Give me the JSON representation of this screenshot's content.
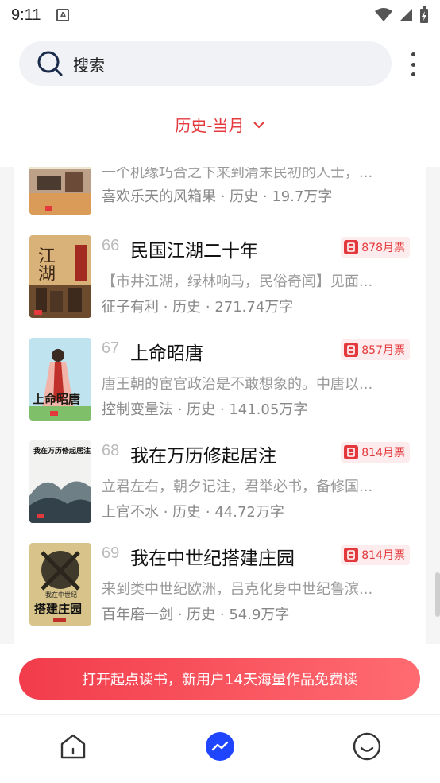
{
  "status": {
    "time": "9:11",
    "notification_glyph": "A"
  },
  "search": {
    "label": "搜索"
  },
  "filter": {
    "label": "历史-当月"
  },
  "books": [
    {
      "rank": "",
      "title": "",
      "tickets": "",
      "desc": "一个机缘巧合之下来到清末民初的人士，...",
      "meta": "喜欢乐天的风箱果 · 历史 · 19.7万字"
    },
    {
      "rank": "66",
      "title": "民国江湖二十年",
      "tickets": "878月票",
      "desc": "【市井江湖，绿林响马，民俗奇闻】见面...",
      "meta": "征子有利 · 历史 · 271.74万字"
    },
    {
      "rank": "67",
      "title": "上命昭唐",
      "tickets": "857月票",
      "desc": "唐王朝的宦官政治是不敢想象的。中唐以...",
      "meta": "控制变量法 · 历史 · 141.05万字"
    },
    {
      "rank": "68",
      "title": "我在万历修起居注",
      "tickets": "814月票",
      "desc": "立君左右，朝夕记注，君举必书，备修国...",
      "meta": "上官不水 · 历史 · 44.72万字"
    },
    {
      "rank": "69",
      "title": "我在中世纪搭建庄园",
      "tickets": "814月票",
      "desc": "来到类中世纪欧洲，吕克化身中世纪鲁滨...",
      "meta": "百年磨一剑 · 历史 · 54.9万字"
    }
  ],
  "covers": {
    "c66": "江湖",
    "c67": "上命昭唐",
    "c68": "我在万历修起居注",
    "c69a": "我在中世纪",
    "c69b": "搭建庄园"
  },
  "promo": {
    "label": "打开起点读书，新用户14天海量作品免费读"
  },
  "colors": {
    "accent": "#e4393c",
    "tab_active": "#1f45ff"
  },
  "icons": [
    "search-icon",
    "more-icon",
    "chevron-down-icon",
    "ticket-icon",
    "home-icon",
    "trending-icon",
    "profile-icon"
  ]
}
